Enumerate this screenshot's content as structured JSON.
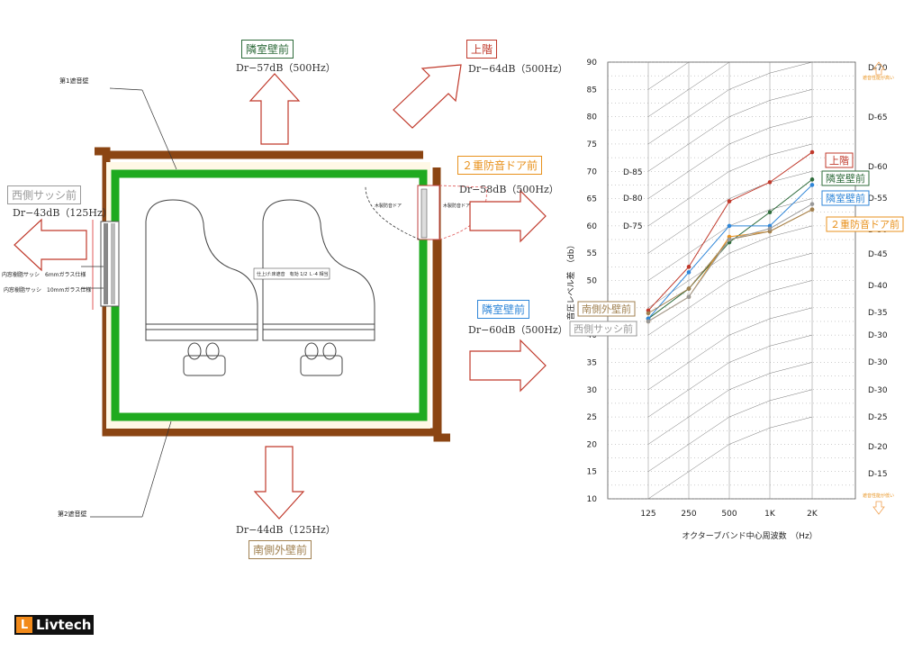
{
  "floor_plan": {
    "wall_label_1": "第1遮音壁",
    "wall_label_2": "第2遮音壁",
    "sash_label_outer": "内窓樹脂サッシ　6mmガラス仕様",
    "sash_label_inner": "内窓樹脂サッシ　10mmガラス仕様",
    "door_label_left": "木製防音ドア",
    "door_label_right": "木製防音ドア",
    "floor_note": "仕上げ:床遮音　有効 1/2 Ｌ-4 相当",
    "directions": {
      "north": {
        "title": "隣室壁前",
        "value": "Dr−57dB（500Hz）",
        "color": "#2e6b3a"
      },
      "upstairs": {
        "title": "上階",
        "value": "Dr−64dB（500Hz）",
        "color": "#c0392b"
      },
      "door": {
        "title": "２重防音ドア前",
        "value": "Dr−58dB（500Hz）",
        "color": "#e8911c"
      },
      "east": {
        "title": "隣室壁前",
        "value": "Dr−60dB（500Hz）",
        "color": "#2f86d8"
      },
      "west": {
        "title": "西側サッシ前",
        "value": "Dr−43dB（125Hz）",
        "color": "#999999"
      },
      "south": {
        "title": "南側外壁前",
        "value": "Dr−44dB（125Hz）",
        "color": "#a08050"
      }
    }
  },
  "chart_data": {
    "type": "line",
    "xlabel": "オクターブバンド中心周波数　（Hz）",
    "ylabel": "音圧レベル差　（db）",
    "categories": [
      "125",
      "250",
      "500",
      "1K",
      "2K"
    ],
    "ylim": [
      10,
      90
    ],
    "yticks": [
      10,
      15,
      20,
      25,
      30,
      35,
      40,
      45,
      50,
      55,
      60,
      65,
      70,
      75,
      80,
      85,
      90
    ],
    "right_ticks": [
      "D-70",
      "D-65",
      "D-60",
      "D-55",
      "D-50",
      "D-45",
      "D-40",
      "D-35",
      "D-30",
      "D-30",
      "D-30",
      "D-25",
      "D-20",
      "D-15"
    ],
    "left_dr_labels": [
      "D-85",
      "D-80",
      "D-75"
    ],
    "top_note": "遮音性能が高い",
    "bottom_note": "遮音性能が低い",
    "grid": true,
    "series": [
      {
        "name": "上階",
        "color": "#c0392b",
        "values": [
          44.5,
          52.5,
          64.5,
          68,
          73.5
        ]
      },
      {
        "name": "隣室壁前",
        "color": "#2e6b3a",
        "values": [
          43,
          48.5,
          57,
          62.5,
          68.5
        ]
      },
      {
        "name": "隣室壁前",
        "color": "#2f86d8",
        "values": [
          43,
          51.5,
          60,
          60,
          67.5
        ]
      },
      {
        "name": "２重防音ドア前",
        "color": "#e8911c",
        "values": [
          42.5,
          47,
          58,
          59,
          63
        ]
      },
      {
        "name": "南側外壁前",
        "color": "#a08050",
        "values": [
          44,
          48.5,
          57.5,
          59,
          63
        ]
      },
      {
        "name": "西側サッシ前",
        "color": "#999999",
        "values": [
          42.5,
          47,
          57.5,
          59.5,
          64
        ]
      }
    ]
  },
  "logo": {
    "text": "Livtech",
    "mark": "L"
  }
}
